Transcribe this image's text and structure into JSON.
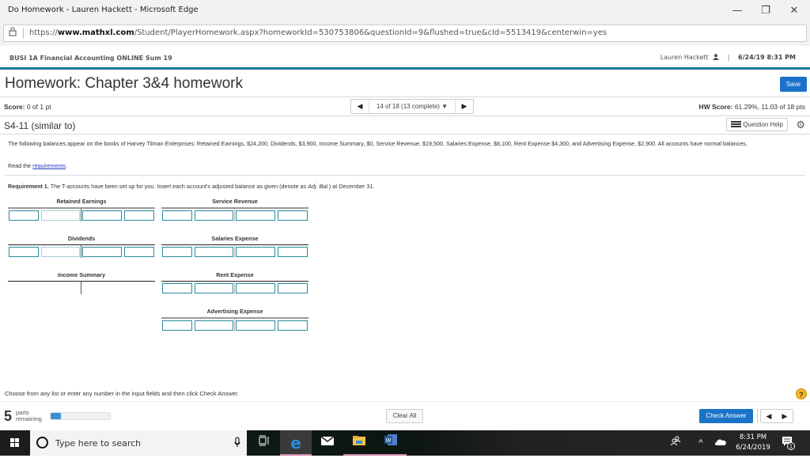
{
  "window": {
    "title": "Do Homework - Lauren Hackett - Microsoft Edge",
    "minimize_icon": "—",
    "restore_icon": "❐",
    "close_icon": "✕"
  },
  "browser": {
    "url_prefix": "https://",
    "url_domain": "www.mathxl.com",
    "url_path": "/Student/PlayerHomework.aspx?homeworkId=530753806&questionId=9&flushed=true&cId=5513419&centerwin=yes"
  },
  "course": {
    "name": "BUSI 1A Financial Accounting ONLINE Sum 19",
    "user_name": "Lauren Hackett",
    "separator": "|",
    "datetime": "6/24/19 8:31 PM"
  },
  "homework": {
    "title": "Homework: Chapter 3&4 homework",
    "save_label": "Save"
  },
  "score": {
    "label": "Score:",
    "value": "0 of 1 pt",
    "question_selector": "14 of 18 (13 complete)",
    "hw_score_label": "HW Score:",
    "hw_score_value": "61.29%, 11.03 of 18 pts"
  },
  "question": {
    "id": "S4-11 (similar to)",
    "help_label": "Question Help",
    "text": "The following balances appear on the books of Harvey Tilman Enterprises: Retained Earnings, $24,200, Dividends, $3,900, Income Summary, $0, Service Revenue, $19,500, Salaries Expense, $8,100, Rent Expense $4,300, and Advertising Expense, $2,900. All accounts have normal balances.",
    "read_prefix": "Read the ",
    "read_link": "requirements",
    "read_suffix": ".",
    "req_label": "Requirement 1.",
    "req_text_a": " The T-accounts have been set up for you. Insert each account's adjusted balance as given (denote as ",
    "req_text_italic": "Adj. Bal.",
    "req_text_b": ") at December 31."
  },
  "taccounts": {
    "retained_earnings": "Retained Earnings",
    "service_revenue": "Service Revenue",
    "dividends": "Dividends",
    "salaries_expense": "Salaries Expense",
    "income_summary": "Income Summary",
    "rent_expense": "Rent Expense",
    "advertising_expense": "Advertising Expense"
  },
  "footer": {
    "instruction": "Choose from any list or enter any number in the input fields and then click Check Answer.",
    "parts_count": "5",
    "parts_label_1": "parts",
    "parts_label_2": "remaining",
    "progress_fraction": 0.17,
    "clear_label": "Clear All",
    "check_label": "Check Answer"
  },
  "taskbar": {
    "search_placeholder": "Type here to search",
    "time": "8:31 PM",
    "date": "6/24/2019",
    "notification_count": "1"
  }
}
